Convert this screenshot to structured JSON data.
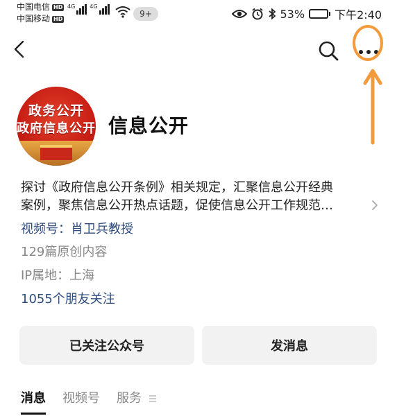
{
  "status_bar": {
    "carrier1": "中国电信",
    "carrier2": "中国移动",
    "hd_badge": "HD",
    "network1": "4G",
    "network2": "4G",
    "notification_count": "9+",
    "battery": "53%",
    "time": "下午2:40",
    "battery_level": 0.53
  },
  "nav": {
    "back_icon": "chevron-left-icon",
    "search_icon": "search-icon",
    "more_icon": "more-dots-icon",
    "annotation_color": "#f39a3c"
  },
  "profile": {
    "avatar_line1": "政务公开",
    "avatar_line2": "政府信息公开",
    "name": "信息公开",
    "description_line1": "探讨《政府信息公开条例》相关规定，汇聚信息公开经典",
    "description_line2": "案例，聚焦信息公开热点话题，促使信息公开工作规范…",
    "channels": "视频号：肖卫兵教授",
    "original_count": "129篇原创内容",
    "ip_location": "IP属地：上海",
    "friends_follow": "1055个朋友关注",
    "link_color": "#2e4d7e"
  },
  "actions": {
    "followed": "已关注公众号",
    "send_message": "发消息"
  },
  "tabs": [
    {
      "label": "消息",
      "active": true
    },
    {
      "label": "视频号",
      "active": false
    },
    {
      "label": "服务",
      "active": false
    }
  ]
}
